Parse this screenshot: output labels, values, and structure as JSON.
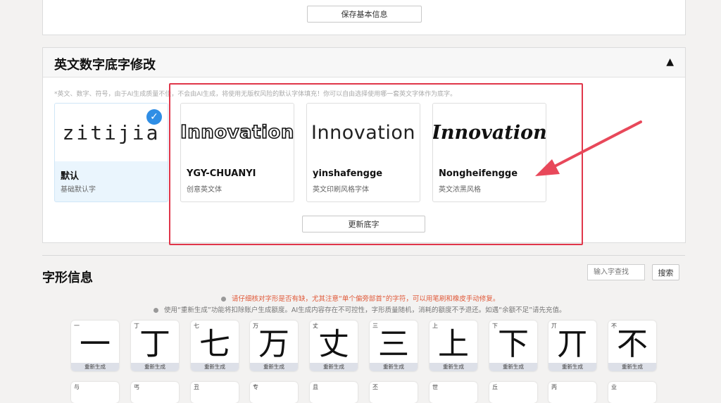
{
  "basic_info": {
    "save_button": "保存基本信息"
  },
  "font_section": {
    "title": "英文数字底字修改",
    "collapse_icon": "▲",
    "note": "*英文、数字、符号，由于AI生成质量不佳，不会由AI生成，将使用无版权风险的默认字体填充！你可以自由选择使用哪一套英文字体作为底字。",
    "cards": [
      {
        "preview": "zitijia",
        "name": "默认",
        "desc": "基础默认字",
        "selected": true
      },
      {
        "preview": "Innovation",
        "name": "YGY-CHUANYI",
        "desc": "创意英文体"
      },
      {
        "preview": "Innovation",
        "name": "yinshafengge",
        "desc": "英文印刷风格字体"
      },
      {
        "preview": "Innovation",
        "name": "Nongheifengge",
        "desc": "英文浓黑风格"
      }
    ],
    "update_button": "更新底字",
    "highlight_color": "#e0364a",
    "accent_color": "#2f8ee5"
  },
  "glyph_section": {
    "title": "字形信息",
    "search_placeholder": "输入字查找",
    "search_button": "搜索",
    "notice_1": "请仔细核对字形是否有缺，尤其注意“单个偏旁部首”的字符，可以用笔刷和橡皮手动修复。",
    "notice_2": "使用“重新生成”功能将扣除账户生成额度。AI生成内容存在不可控性，字形质量随机，消耗的额度不予退还。如遇“余额不足”请先充值。",
    "regen_label": "重新生成",
    "row1": [
      {
        "label": "一",
        "char": "一"
      },
      {
        "label": "丁",
        "char": "丁"
      },
      {
        "label": "七",
        "char": "七"
      },
      {
        "label": "万",
        "char": "万"
      },
      {
        "label": "丈",
        "char": "丈"
      },
      {
        "label": "三",
        "char": "三"
      },
      {
        "label": "上",
        "char": "上"
      },
      {
        "label": "下",
        "char": "下"
      },
      {
        "label": "丌",
        "char": "丌"
      },
      {
        "label": "不",
        "char": "不"
      }
    ],
    "row2": [
      {
        "label": "与"
      },
      {
        "label": "丐"
      },
      {
        "label": "丑"
      },
      {
        "label": "专"
      },
      {
        "label": "且"
      },
      {
        "label": "丕"
      },
      {
        "label": "世"
      },
      {
        "label": "丘"
      },
      {
        "label": "丙"
      },
      {
        "label": "业"
      }
    ]
  }
}
